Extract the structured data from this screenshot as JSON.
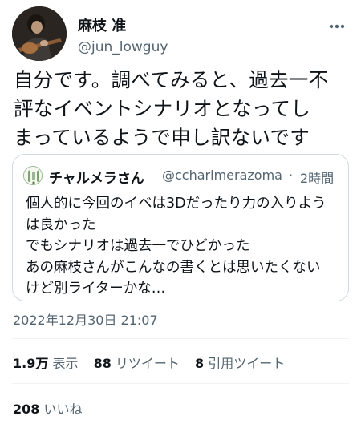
{
  "author": {
    "display_name": "麻枝 准",
    "handle": "@jun_lowguy",
    "avatar_icon": "avatar-photo-guitarist"
  },
  "more_icon": "more-icon",
  "tweet": {
    "lines": [
      "自分です。調べてみると、過去一不",
      "評なイベントシナリオとなってし",
      "まっているようで申し訳ないです"
    ]
  },
  "quoted_tweet": {
    "display_name": "チャルメラさん",
    "handle": "@ccharimerazoma",
    "separator": "·",
    "time": "2時間",
    "lines": [
      "個人的に今回のイベは3Dだったり力の入りよう",
      "は良かった",
      "でもシナリオは過去一でひどかった",
      "あの麻枝さんがこんなの書くとは思いたくない",
      "けど別ライターかな…"
    ]
  },
  "timestamp": "2022年12月30日 21:07",
  "stats": {
    "views_count": "1.9万",
    "views_label": "表示",
    "retweets_count": "88",
    "retweets_label": "リツイート",
    "quotes_count": "8",
    "quotes_label": "引用ツイート",
    "likes_count": "208",
    "likes_label": "いいね"
  },
  "colors": {
    "text": "#0f1419",
    "secondary": "#536471",
    "border": "#cfd9de",
    "divider": "#eff3f4"
  }
}
